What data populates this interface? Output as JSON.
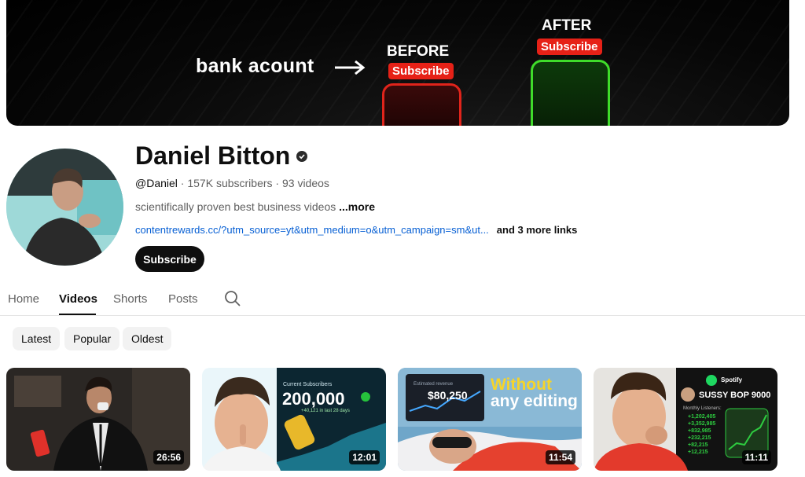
{
  "banner": {
    "text": "bank acount",
    "before_label": "BEFORE",
    "after_label": "AFTER",
    "subscribe_pill": "Subscribe"
  },
  "channel": {
    "name": "Daniel Bitton",
    "handle": "@Daniel",
    "subscribers": "157K subscribers",
    "videos_count": "93 videos",
    "separator": " · ",
    "description": "scientifically proven best business videos",
    "more_label": "...more",
    "link": "contentrewards.cc/?utm_source=yt&utm_medium=o&utm_campaign=sm&ut...",
    "more_links": "and 3 more links",
    "subscribe_label": "Subscribe"
  },
  "tabs": [
    {
      "label": "Home",
      "active": false
    },
    {
      "label": "Videos",
      "active": true
    },
    {
      "label": "Shorts",
      "active": false
    },
    {
      "label": "Posts",
      "active": false
    }
  ],
  "chips": [
    "Latest",
    "Popular",
    "Oldest"
  ],
  "videos": [
    {
      "duration": "26:56"
    },
    {
      "duration": "12:01",
      "overlay_caption": "Current Subscribers",
      "overlay_number": "200,000",
      "overlay_sub": "+40,121 in last 28 days"
    },
    {
      "duration": "11:54",
      "overlay_caption": "Estimated revenue",
      "overlay_number": "$80,250",
      "overlay_title_1": "Without",
      "overlay_title_2": "any editing"
    },
    {
      "duration": "11:11",
      "overlay_app": "Spotify",
      "overlay_name": "SUSSY BOP 9000",
      "overlay_caption": "Monthly Listeners:",
      "overlay_values": [
        "+1,202,405",
        "+3,352,985",
        "+832,985",
        "+232,215",
        "+82,215",
        "+12,215"
      ]
    }
  ],
  "colors": {
    "accent_red": "#e62117",
    "link_blue": "#065fd4",
    "green": "#3fdc2a"
  }
}
